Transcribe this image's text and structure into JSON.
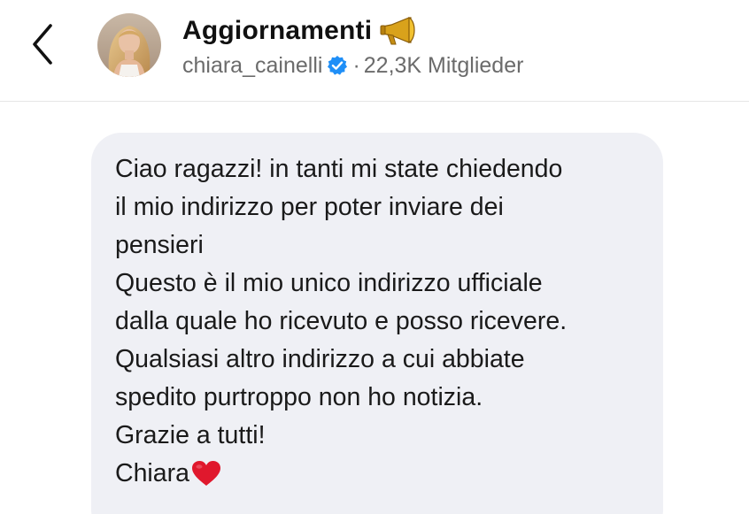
{
  "header": {
    "back_icon": "chevron-left-icon",
    "avatar_icon": "profile-photo",
    "title": "Aggiornamenti",
    "title_emoji_icon": "megaphone-icon",
    "username": "chiara_cainelli",
    "verified_icon": "verified-badge-icon",
    "separator": "·",
    "members": "22,3K Mitglieder"
  },
  "message": {
    "lines": [
      "Ciao ragazzi! in tanti mi state chiedendo",
      "il mio indirizzo per poter inviare dei",
      "pensieri",
      "Questo è il mio unico indirizzo ufficiale",
      "dalla quale ho ricevuto e posso ricevere.",
      "Qualsiasi altro indirizzo a cui abbiate",
      "spedito purtroppo non ho notizia.",
      "Grazie a tutti!",
      "Chiara"
    ],
    "signature_emoji_icon": "red-heart-icon"
  },
  "colors": {
    "bubble_background": "#eff0f5",
    "verified_blue": "#1f8ff7",
    "heart_red": "#e0182d",
    "secondary_text": "#6b6b6b"
  }
}
